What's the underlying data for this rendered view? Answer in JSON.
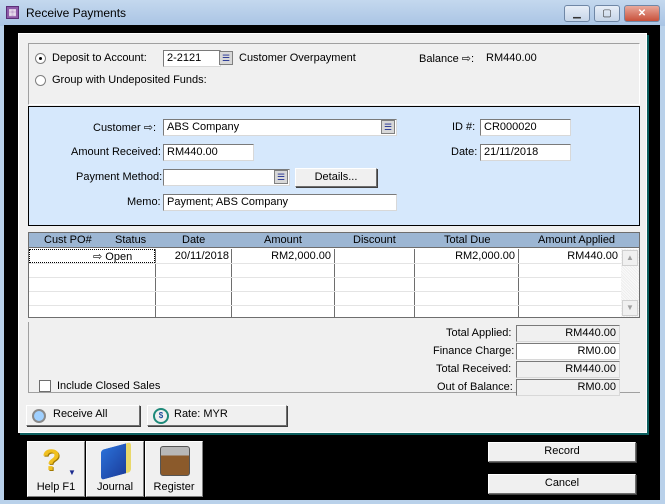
{
  "window": {
    "title": "Receive Payments",
    "min_glyph": "▁",
    "max_glyph": "▢",
    "close_glyph": "✕"
  },
  "deposit": {
    "deposit_label": "Deposit to Account:",
    "deposit_selected": true,
    "account_code": "2-2121",
    "account_name": "Customer Overpayment",
    "balance_label": "Balance ⇨:",
    "balance_value": "RM440.00",
    "group_label": "Group with Undeposited Funds:",
    "group_selected": false
  },
  "customer": {
    "customer_label": "Customer ⇨:",
    "customer_value": "ABS Company",
    "id_label": "ID #:",
    "id_value": "CR000020",
    "amount_label": "Amount Received:",
    "amount_value": "RM440.00",
    "date_label": "Date:",
    "date_value": "21/11/2018",
    "method_label": "Payment Method:",
    "method_value": "",
    "details_button": "Details...",
    "memo_label": "Memo:",
    "memo_value": "Payment; ABS Company"
  },
  "grid": {
    "headers": [
      "Cust PO#",
      "Status",
      "Date",
      "Amount",
      "Discount",
      "Total Due",
      "Amount Applied"
    ],
    "rows": [
      {
        "cust_po": "",
        "status": "⇨ Open",
        "date": "20/11/2018",
        "amount": "RM2,000.00",
        "discount": "",
        "total_due": "RM2,000.00",
        "amount_applied": "RM440.00"
      }
    ],
    "scroll_up": "▲",
    "scroll_down": "▼"
  },
  "totals": {
    "total_applied_label": "Total Applied:",
    "total_applied_value": "RM440.00",
    "finance_charge_label": "Finance Charge:",
    "finance_charge_value": "RM0.00",
    "total_received_label": "Total Received:",
    "total_received_value": "RM440.00",
    "out_of_balance_label": "Out of Balance:",
    "out_of_balance_value": "RM0.00"
  },
  "options": {
    "include_closed_label": "Include Closed Sales",
    "include_closed_checked": false,
    "receive_all_button": "Receive All",
    "rate_button": "Rate:  MYR"
  },
  "toolbar": {
    "help_label": "Help F1",
    "journal_label": "Journal",
    "register_label": "Register"
  },
  "actions": {
    "record_label": "Record",
    "cancel_label": "Cancel"
  }
}
